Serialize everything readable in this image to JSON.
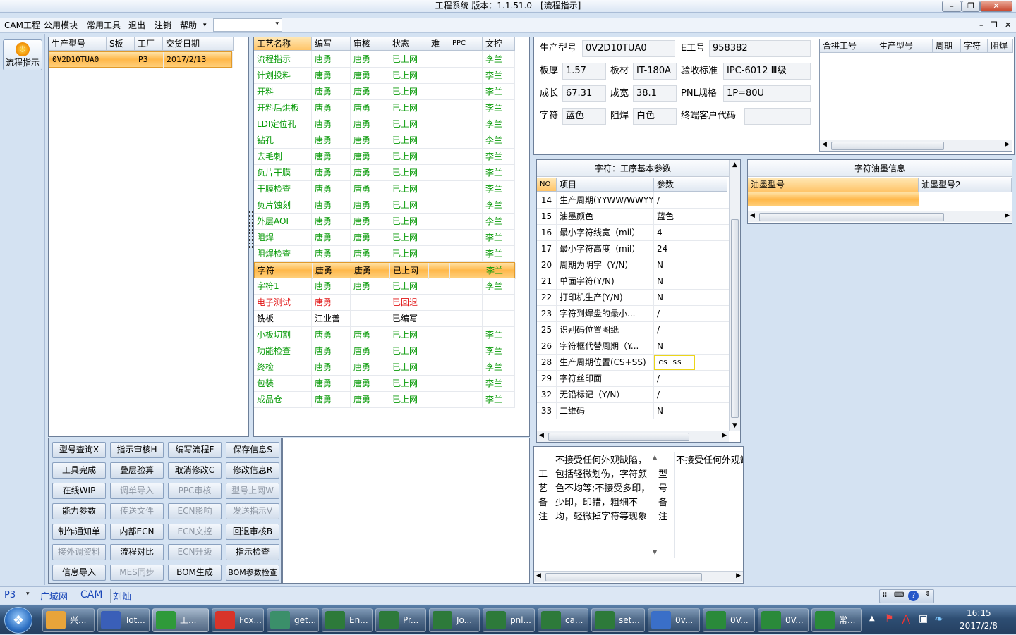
{
  "window": {
    "title": "工程系统   版本：1.1.51.0 - [流程指示]"
  },
  "menu": {
    "items": [
      "CAM工程",
      "公用模块",
      "常用工具",
      "退出",
      "注销",
      "帮助"
    ]
  },
  "left_tool": {
    "label": "流程指示"
  },
  "order_table": {
    "headers": [
      "生产型号",
      "S板",
      "工厂",
      "交货日期"
    ],
    "rows": [
      [
        "0V2D10TUA0",
        "",
        "P3",
        "2017/2/13"
      ]
    ]
  },
  "process_table": {
    "headers": [
      "工艺名称",
      "编写",
      "审核",
      "状态",
      "难",
      "PPC",
      "文控"
    ],
    "rows": [
      [
        "流程指示",
        "唐勇",
        "唐勇",
        "已上网",
        "",
        "",
        "李兰"
      ],
      [
        "计划投料",
        "唐勇",
        "唐勇",
        "已上网",
        "",
        "",
        "李兰"
      ],
      [
        "开料",
        "唐勇",
        "唐勇",
        "已上网",
        "",
        "",
        "李兰"
      ],
      [
        "开料后烘板",
        "唐勇",
        "唐勇",
        "已上网",
        "",
        "",
        "李兰"
      ],
      [
        "LDI定位孔",
        "唐勇",
        "唐勇",
        "已上网",
        "",
        "",
        "李兰"
      ],
      [
        "钻孔",
        "唐勇",
        "唐勇",
        "已上网",
        "",
        "",
        "李兰"
      ],
      [
        "去毛刺",
        "唐勇",
        "唐勇",
        "已上网",
        "",
        "",
        "李兰"
      ],
      [
        "负片干膜",
        "唐勇",
        "唐勇",
        "已上网",
        "",
        "",
        "李兰"
      ],
      [
        "干膜检查",
        "唐勇",
        "唐勇",
        "已上网",
        "",
        "",
        "李兰"
      ],
      [
        "负片蚀刻",
        "唐勇",
        "唐勇",
        "已上网",
        "",
        "",
        "李兰"
      ],
      [
        "外层AOI",
        "唐勇",
        "唐勇",
        "已上网",
        "",
        "",
        "李兰"
      ],
      [
        "阻焊",
        "唐勇",
        "唐勇",
        "已上网",
        "",
        "",
        "李兰"
      ],
      [
        "阻焊检查",
        "唐勇",
        "唐勇",
        "已上网",
        "",
        "",
        "李兰"
      ],
      [
        "字符",
        "唐勇",
        "唐勇",
        "已上网",
        "",
        "",
        "李兰"
      ],
      [
        "字符1",
        "唐勇",
        "唐勇",
        "已上网",
        "",
        "",
        "李兰"
      ],
      [
        "电子测试",
        "唐勇",
        "",
        "已回退",
        "",
        "",
        ""
      ],
      [
        "铣板",
        "江业善",
        "",
        "已编写",
        "",
        "",
        ""
      ],
      [
        "小板切割",
        "唐勇",
        "唐勇",
        "已上网",
        "",
        "",
        "李兰"
      ],
      [
        "功能检查",
        "唐勇",
        "唐勇",
        "已上网",
        "",
        "",
        "李兰"
      ],
      [
        "终检",
        "唐勇",
        "唐勇",
        "已上网",
        "",
        "",
        "李兰"
      ],
      [
        "包装",
        "唐勇",
        "唐勇",
        "已上网",
        "",
        "",
        "李兰"
      ],
      [
        "成品仓",
        "唐勇",
        "唐勇",
        "已上网",
        "",
        "",
        "李兰"
      ]
    ],
    "row_colors": [
      "green",
      "green",
      "green",
      "green",
      "green",
      "green",
      "green",
      "green",
      "green",
      "green",
      "green",
      "green",
      "green",
      "black",
      "green",
      "red",
      "black",
      "green",
      "green",
      "green",
      "green",
      "green"
    ]
  },
  "buttons": [
    [
      "型号查询X",
      "指示审核H",
      "编写流程F",
      "保存信息S"
    ],
    [
      "工具完成",
      "叠层验算",
      "取消修改C",
      "修改信息R"
    ],
    [
      "在线WIP",
      "调单导入",
      "PPC审核",
      "型号上网W"
    ],
    [
      "能力参数",
      "传送文件",
      "ECN影响",
      "发送指示V"
    ],
    [
      "制作通知单",
      "内部ECN",
      "ECN文控",
      "回退审核B"
    ],
    [
      "接外调资料",
      "流程对比",
      "ECN升级",
      "指示检查"
    ],
    [
      "信息导入",
      "MES同步",
      "BOM生成",
      "BOM参数检查"
    ]
  ],
  "buttons_disabled": [
    [
      false,
      false,
      false,
      false
    ],
    [
      false,
      false,
      false,
      false
    ],
    [
      false,
      true,
      true,
      true
    ],
    [
      false,
      true,
      true,
      true
    ],
    [
      false,
      false,
      true,
      false
    ],
    [
      true,
      false,
      true,
      false
    ],
    [
      false,
      true,
      false,
      false
    ]
  ],
  "info": {
    "model_label": "生产型号",
    "model": "0V2D10TUA0",
    "eno_label": "E工号",
    "eno": "958382",
    "thickness_label": "板厚",
    "thickness": "1.57",
    "material_label": "板材",
    "material": "IT-180A",
    "standard_label": "验收标准",
    "standard": "IPC-6012 Ⅲ级",
    "length_label": "成长",
    "length": "67.31",
    "width_label": "成宽",
    "width": "38.1",
    "pnl_label": "PNL规格",
    "pnl": "1P=80U",
    "char_label": "字符",
    "char": "蓝色",
    "mask_label": "阻焊",
    "mask": "白色",
    "customer_label": "终端客户代码",
    "customer": ""
  },
  "combine_table": {
    "headers": [
      "合拼工号",
      "生产型号",
      "周期",
      "字符",
      "阻焊"
    ]
  },
  "params": {
    "title": "字符：工序基本参数",
    "headers": [
      "NO",
      "项目",
      "参数"
    ],
    "rows": [
      [
        "14",
        "生产周期(YYWW/WWYY)",
        "/"
      ],
      [
        "15",
        "油墨颜色",
        "蓝色"
      ],
      [
        "16",
        "最小字符线宽（mil）",
        "4"
      ],
      [
        "17",
        "最小字符高度（mil）",
        "24"
      ],
      [
        "20",
        "周期为阴字（Y/N）",
        "N"
      ],
      [
        "21",
        "单面字符(Y/N)",
        "N"
      ],
      [
        "22",
        "打印机生产(Y/N)",
        "N"
      ],
      [
        "23",
        "字符到焊盘的最小...",
        "/"
      ],
      [
        "25",
        "识别码位置图纸",
        "/"
      ],
      [
        "26",
        "字符框代替周期（Y...",
        "N"
      ],
      [
        "28",
        "生产周期位置(CS+SS)",
        "cs+ss"
      ],
      [
        "29",
        "字符丝印面",
        "/"
      ],
      [
        "32",
        "无铅标记（Y/N）",
        "/"
      ],
      [
        "33",
        "二维码",
        "N"
      ]
    ]
  },
  "ink": {
    "title": "字符油墨信息",
    "headers": [
      "油墨型号",
      "油墨型号2"
    ]
  },
  "notes": {
    "process_label": "工艺备注",
    "process_text": "不接受任何外观缺陷，包括轻微划伤，字符颜色不均等;不接受多印，少印，印错，粗细不均，轻微掉字符等现象",
    "model_label": "型号备注",
    "model_text": "不接受任何外观缺陷，包括轻微划伤"
  },
  "statusbar": {
    "factory": "P3",
    "items": [
      "广域网",
      "CAM",
      "刘灿"
    ]
  },
  "taskbar": {
    "items": [
      "兴...",
      "Tot...",
      "工...",
      "Fox...",
      "get...",
      "En...",
      "Pr...",
      "Jo...",
      "pnl...",
      "ca...",
      "set...",
      "0v...",
      "0V...",
      "0V...",
      "常..."
    ],
    "icon_colors": [
      "#e8a43a",
      "#3a5fb8",
      "#2f9a3a",
      "#d8342a",
      "#3b8f6a",
      "#2d7a3a",
      "#2d7a3a",
      "#2d7a3a",
      "#2d7a3a",
      "#2d7a3a",
      "#2d7a3a",
      "#3a6fc8",
      "#2a8a3a",
      "#2a8a3a",
      "#2a8a3a"
    ],
    "time": "16:15",
    "date": "2017/2/8"
  }
}
